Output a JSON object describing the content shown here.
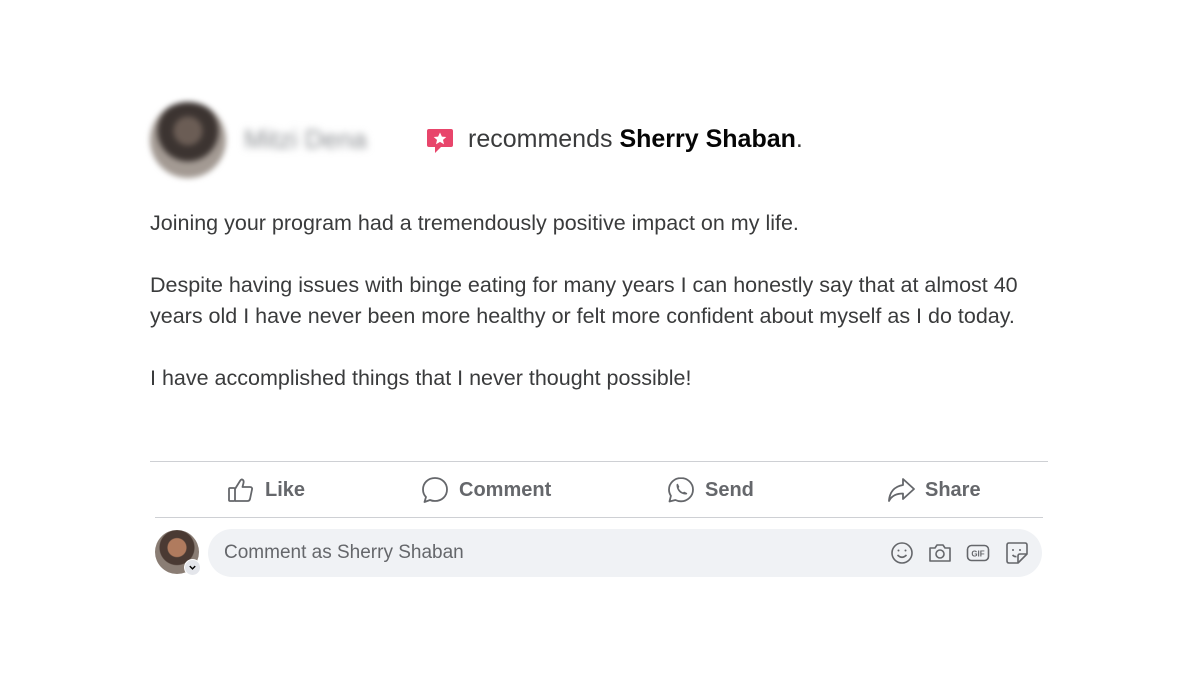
{
  "header": {
    "author_name": "Mitzi Dena",
    "recommends_text": "recommends",
    "page_name": "Sherry Shaban",
    "period": "."
  },
  "post": {
    "paragraphs": [
      "Joining your program had a tremendously positive impact on my life.",
      "Despite having issues with binge eating for many years I can honestly say that at almost 40 years old I have never been more healthy or felt more confident about myself as I do today.",
      "I have accomplished things that I never thought possible!"
    ]
  },
  "actions": {
    "like": "Like",
    "comment": "Comment",
    "send": "Send",
    "share": "Share"
  },
  "comment_box": {
    "placeholder": "Comment as Sherry Shaban",
    "icons": [
      "emoji-icon",
      "camera-icon",
      "gif-icon",
      "sticker-icon"
    ],
    "gif_label": "GIF"
  },
  "colors": {
    "recommend_icon": "#e8456b",
    "muted_text": "#65676b",
    "input_bg": "#f0f2f5"
  }
}
